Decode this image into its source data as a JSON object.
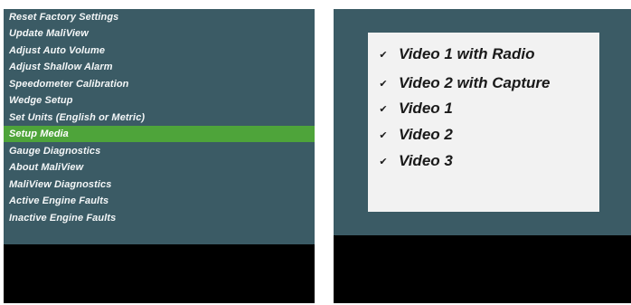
{
  "menu": {
    "items": [
      {
        "label": "Reset Factory Settings"
      },
      {
        "label": "Update MaliView"
      },
      {
        "label": "Adjust Auto Volume"
      },
      {
        "label": "Adjust Shallow Alarm"
      },
      {
        "label": "Speedometer Calibration"
      },
      {
        "label": "Wedge Setup"
      },
      {
        "label": "Set Units (English or Metric)"
      },
      {
        "label": "Setup Media",
        "selected": true
      },
      {
        "label": "Gauge Diagnostics"
      },
      {
        "label": "About MaliView"
      },
      {
        "label": "MaliView Diagnostics"
      },
      {
        "label": "Active Engine Faults"
      },
      {
        "label": "Inactive Engine Faults"
      }
    ]
  },
  "media": {
    "options": [
      {
        "label": "Video 1 with Radio",
        "checked": true
      },
      {
        "label": "Video 2 with Capture",
        "checked": true
      },
      {
        "label": "Video 1",
        "checked": true
      },
      {
        "label": "Video 2",
        "checked": true
      },
      {
        "label": "Video 3",
        "checked": true
      }
    ]
  },
  "colors": {
    "panel": "#3b5b65",
    "selected": "#4ea43a",
    "box": "#f2f2f2"
  },
  "icons": {
    "check": "check-icon"
  }
}
